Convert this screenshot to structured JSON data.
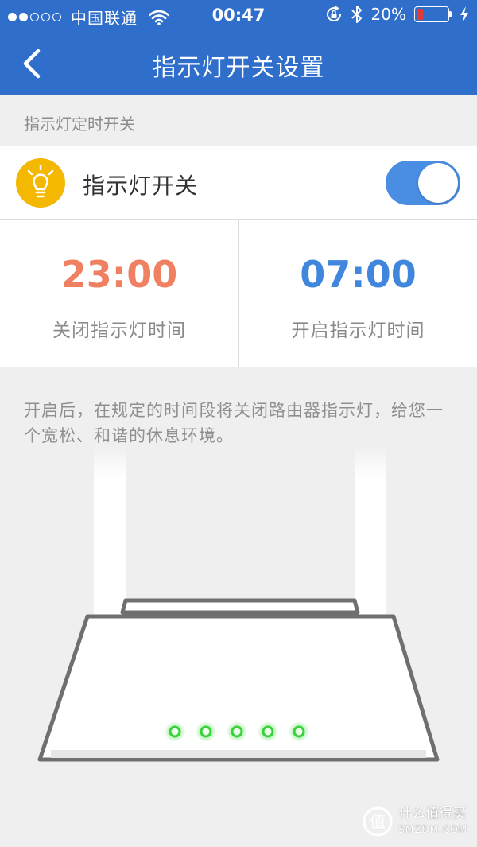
{
  "status_bar": {
    "signal_filled": 2,
    "signal_total": 5,
    "carrier": "中国联通",
    "time": "00:47",
    "battery_percent_text": "20%",
    "battery_level": 0.2
  },
  "header": {
    "title": "指示灯开关设置"
  },
  "section": {
    "label": "指示灯定时开关"
  },
  "switch_row": {
    "label": "指示灯开关",
    "enabled": true
  },
  "schedule": {
    "off_time": "23:00",
    "off_caption": "关闭指示灯时间",
    "on_time": "07:00",
    "on_caption": "开启指示灯时间"
  },
  "description": "开启后，在规定的时间段将关闭路由器指示灯，给您一个宽松、和谐的休息环境。",
  "router": {
    "led_count": 5,
    "led_color": "#3bd13b"
  },
  "watermark": {
    "line1": "什么值得买",
    "line2": "SMZDM.COM"
  },
  "colors": {
    "header_bg": "#2f6fcb",
    "toggle_on": "#4a8ee4",
    "off_time_color": "#ef8062",
    "on_time_color": "#3f86dc",
    "bulb_badge": "#f5b800"
  },
  "icons": {
    "back": "chevron-left-icon",
    "bulb": "lightbulb-icon",
    "wifi": "wifi-icon",
    "lock_rotation": "rotation-lock-icon",
    "bluetooth": "bluetooth-icon",
    "charging": "bolt-icon"
  }
}
